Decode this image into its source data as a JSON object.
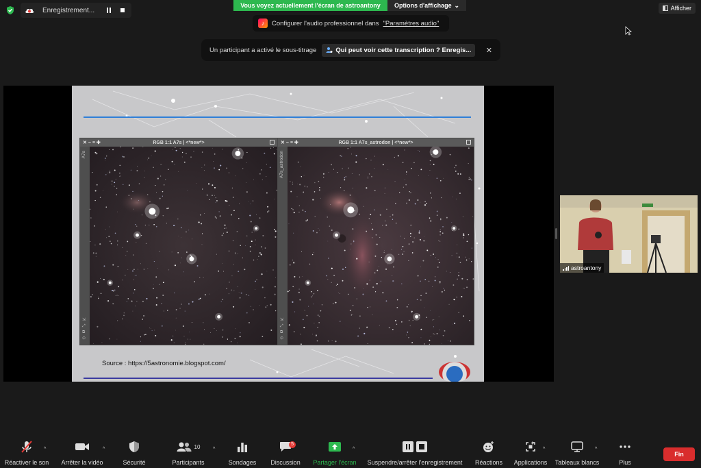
{
  "recording": {
    "label": "Enregistrement..."
  },
  "share_banner": {
    "text": "Vous voyez actuellement l'écran de astroantony",
    "options_label": "Options d'affichage"
  },
  "afficher_label": "Afficher",
  "audio_toast": {
    "text": "Configurer l'audio professionnel dans",
    "link": "\"Paramètres audio\""
  },
  "caption_toast": {
    "text": "Un participant a activé le sous-titrage",
    "question": "Qui peut voir cette transcription ? Enregis..."
  },
  "slide": {
    "source_text": "Source : https://5astronomie.blogspot.com/",
    "windows": [
      {
        "title": "RGB 1:1 A7s | <*new*>",
        "side_label": "A7s"
      },
      {
        "title": "RGB 1:1 A7s_astrodon | <*new*>",
        "side_label": "A7s_astrodon"
      }
    ]
  },
  "self_view": {
    "name": "astroantony"
  },
  "toolbar": {
    "unmute": "Réactiver le son",
    "stop_video": "Arrêter la vidéo",
    "security": "Sécurité",
    "participants": "Participants",
    "participants_count": "10",
    "polls": "Sondages",
    "chat": "Discussion",
    "chat_badge": "5",
    "share": "Partager l'écran",
    "record": "Suspendre/arrêter l'enregistrement",
    "reactions": "Réactions",
    "apps": "Applications",
    "whiteboards": "Tableaux blancs",
    "more": "Plus",
    "end": "Fin"
  },
  "colors": {
    "share_green": "#2db84f",
    "end_red": "#d92d2d",
    "toolbar_bg": "#1a1a1a"
  }
}
